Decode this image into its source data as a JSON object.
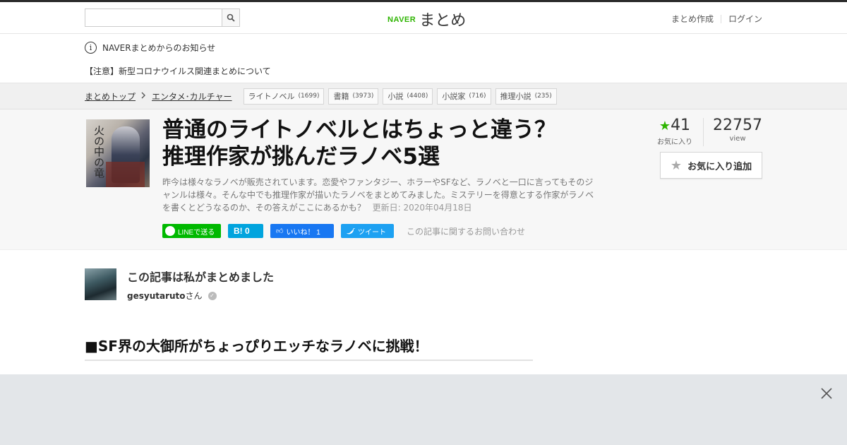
{
  "header": {
    "search": {
      "placeholder": "",
      "value": "",
      "button_icon": "search-icon"
    },
    "logo": {
      "brand": "NAVER",
      "name": "まとめ"
    },
    "nav": [
      {
        "label": "まとめ作成"
      },
      {
        "label": "ログイン"
      }
    ]
  },
  "notice": {
    "title": "NAVERまとめからのお知らせ",
    "message": "【注意】新型コロナウイルス関連まとめについて"
  },
  "breadcrumb": {
    "items": [
      {
        "label": "まとめトップ"
      },
      {
        "label": "エンタメ･カルチャー"
      }
    ],
    "tags": [
      {
        "label": "ライトノベル",
        "count": "(1699)"
      },
      {
        "label": "書籍",
        "count": "(3973)"
      },
      {
        "label": "小説",
        "count": "(4408)"
      },
      {
        "label": "小説家",
        "count": "(716)"
      },
      {
        "label": "推理小説",
        "count": "(235)"
      }
    ]
  },
  "article": {
    "thumbnail_text": "火の中の竜",
    "title_line1": "普通のライトノベルとはちょっと違う？",
    "title_line2": "推理作家が挑んだラノベ5選",
    "description": "昨今は様々なラノベが販売されています。恋愛やファンタジー、ホラーやSFなど、ラノベと一口に言ってもそのジャンルは様々。そんな中でも推理作家が描いたラノベをまとめてみました。ミステリーを得意とする作家がラノベを書くとどうなるのか、その答えがここにあるかも？",
    "updated": "更新日: 2020年04月18日",
    "favorites": {
      "count": "41",
      "label": "お気に入り"
    },
    "views": {
      "count": "22757",
      "label": "view"
    },
    "fav_button": "お気に入り追加",
    "share": {
      "line": "LINEで送る",
      "hatena": "B! 0",
      "facebook": "いいね！ 1",
      "twitter": "ツイート",
      "contact": "この記事に関するお問い合わせ"
    }
  },
  "author": {
    "heading": "この記事は私がまとめました",
    "name": "gesyutaruto",
    "suffix": "さん"
  },
  "section": {
    "title": "■SF界の大御所がちょっぴりエッチなラノベに挑戦！"
  },
  "colors": {
    "naver_green": "#2db400",
    "line": "#00b900",
    "hatena": "#00a4de",
    "facebook": "#1877f2",
    "twitter": "#1da1f2"
  }
}
